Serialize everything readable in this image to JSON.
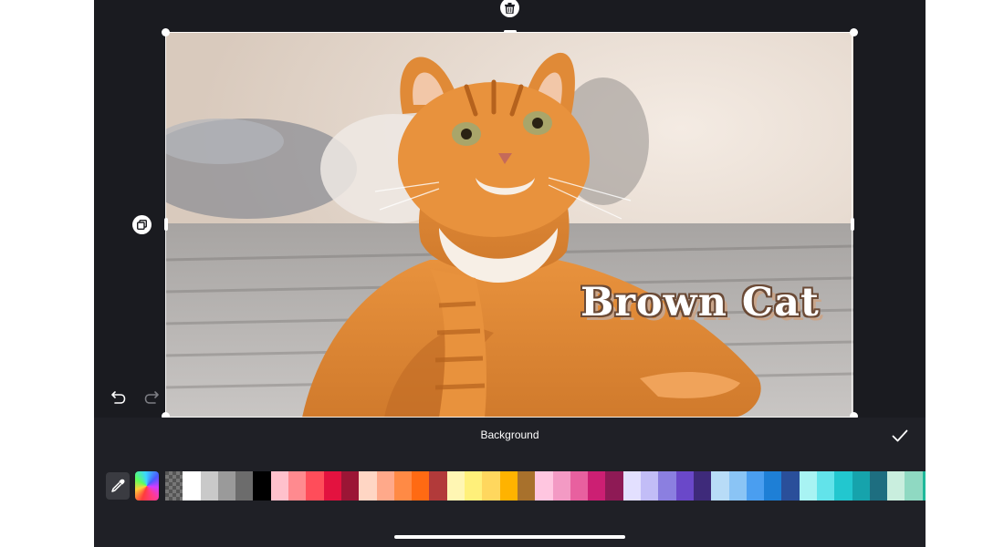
{
  "editor": {
    "overlay_text": "Brown Cat",
    "icons": {
      "delete": "trash-icon",
      "duplicate": "duplicate-icon",
      "undo": "undo-icon",
      "redo": "redo-icon",
      "confirm": "checkmark-icon",
      "eyedropper": "eyedropper-icon"
    }
  },
  "panel": {
    "title": "Background"
  },
  "palette": {
    "swatches": [
      "transparent",
      "#ffffff",
      "#c9c9c9",
      "#9a9a9a",
      "#6c6c6c",
      "#000000",
      "#ffc1cc",
      "#ff8a8f",
      "#ff4d5a",
      "#e3123f",
      "#9b1535",
      "#ffd6c4",
      "#ffa98a",
      "#ff8a45",
      "#ff6a13",
      "#b23a3a",
      "#fff6b3",
      "#fff07a",
      "#ffd75e",
      "#ffb300",
      "#a8712c",
      "#ffc6e0",
      "#f39ac4",
      "#e8609f",
      "#cc1f73",
      "#8e1a55",
      "#e3e0ff",
      "#c2bdf7",
      "#8b7fe0",
      "#6a48c9",
      "#3e2a7a",
      "#b8dcf7",
      "#8ac4f5",
      "#4a9ef0",
      "#1e7fd6",
      "#2a4f9a",
      "#a8f3f3",
      "#62e3ea",
      "#22c7cf",
      "#16a3ac",
      "#1e6e80",
      "#c9eede",
      "#8fd9c2",
      "#1fb89a"
    ]
  }
}
